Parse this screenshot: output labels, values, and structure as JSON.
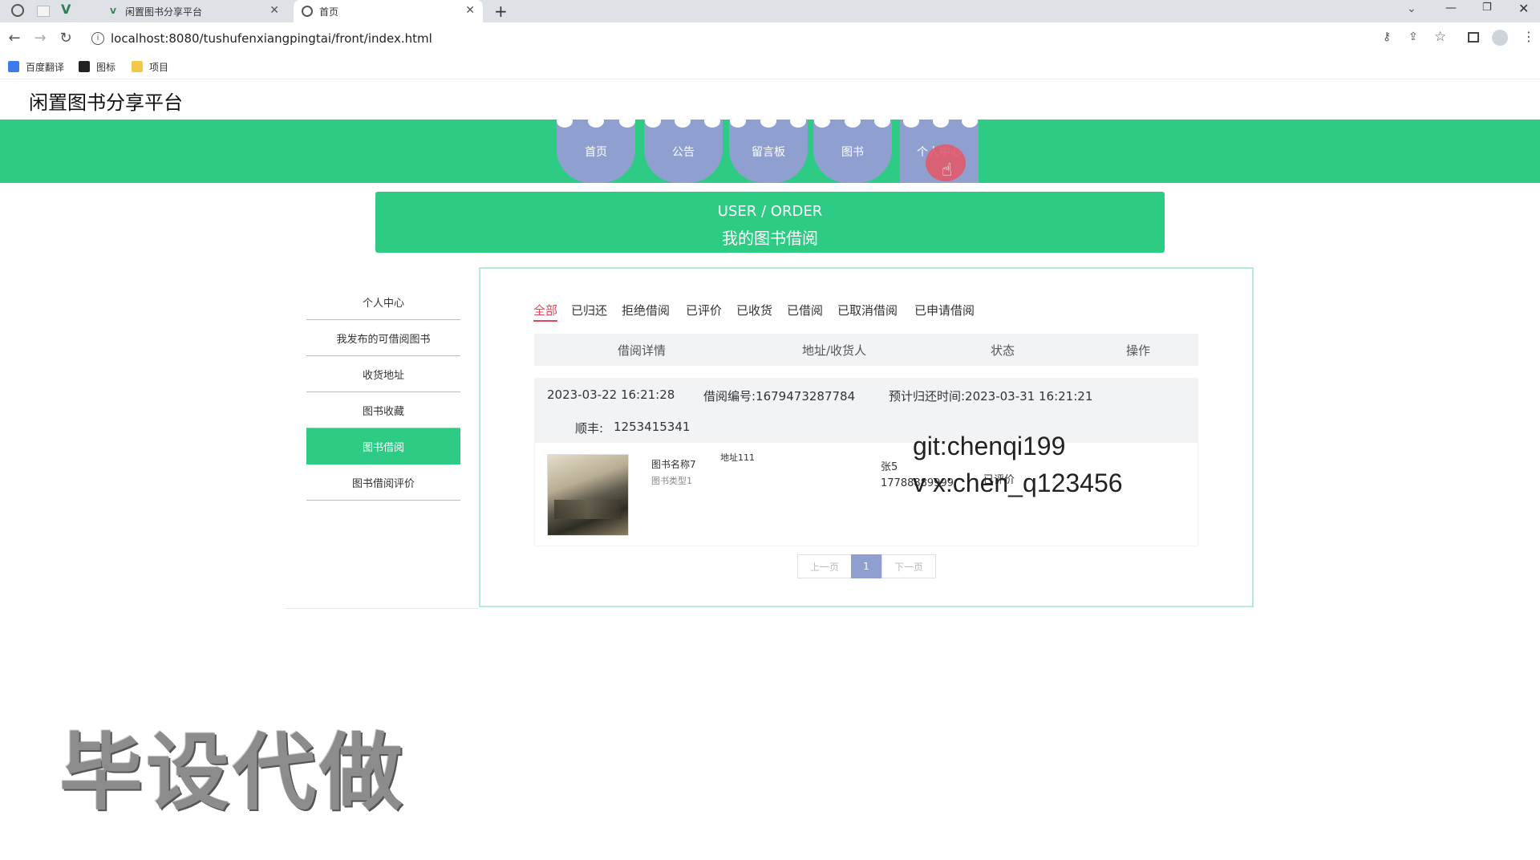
{
  "browser": {
    "tabs": [
      {
        "title": "闲置图书分享平台",
        "active": false
      },
      {
        "title": "首页",
        "active": true
      }
    ],
    "new_tab": "+",
    "url": "localhost:8080/tushufenxiangpingtai/front/index.html",
    "bookmarks": [
      "百度翻译",
      "图标",
      "项目"
    ]
  },
  "site": {
    "title": "闲置图书分享平台",
    "nav": [
      "首页",
      "公告",
      "留言板",
      "图书",
      "个人中心"
    ],
    "accent": "#2dcb83",
    "nav_color": "#8f9fd0"
  },
  "banner": {
    "line1": "USER / ORDER",
    "line2": "我的图书借阅"
  },
  "sidebar": {
    "items": [
      "个人中心",
      "我发布的可借阅图书",
      "收货地址",
      "图书收藏",
      "图书借阅",
      "图书借阅评价"
    ],
    "active_index": 4
  },
  "filters": {
    "items": [
      "全部",
      "已归还",
      "拒绝借阅",
      "已评价",
      "已收货",
      "已借阅",
      "已取消借阅",
      "已申请借阅"
    ],
    "active_index": 0
  },
  "table": {
    "headers": [
      "借阅详情",
      "地址/收货人",
      "状态",
      "操作"
    ]
  },
  "order": {
    "datetime": "2023-03-22 16:21:28",
    "number": "借阅编号:1679473287784",
    "return_time": "预计归还时间:2023-03-31 16:21:21",
    "courier": "顺丰:",
    "tracking": "1253415341",
    "book_name": "图书名称7",
    "book_type": "图书类型1",
    "address": "地址111",
    "receiver": "张5",
    "phone": "17788889999",
    "status": "已评价"
  },
  "pagination": {
    "prev": "上一页",
    "current": "1",
    "next": "下一页"
  },
  "watermarks": {
    "git": "git:chenqi199",
    "vx": "v x:chen_q123456",
    "big": "毕设代做"
  }
}
